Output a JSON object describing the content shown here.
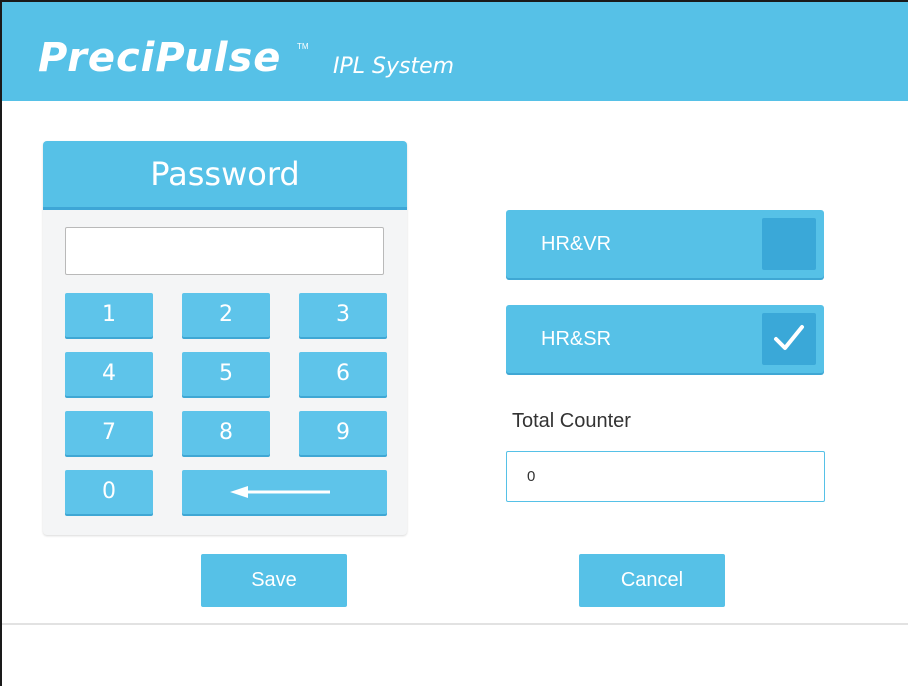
{
  "header": {
    "logo": "PreciPulse",
    "trademark": "TM",
    "subtitle": "IPL System",
    "color": "#56c1e7"
  },
  "keypad": {
    "title": "Password",
    "password_value": "",
    "keys": [
      "1",
      "2",
      "3",
      "4",
      "5",
      "6",
      "7",
      "8",
      "9",
      "0"
    ],
    "backspace_icon": "left-arrow-icon"
  },
  "options": {
    "hrvr": {
      "label": "HR&VR",
      "checked": false
    },
    "hrsr": {
      "label": "HR&SR",
      "checked": true
    }
  },
  "counter": {
    "label": "Total Counter",
    "value": "0"
  },
  "actions": {
    "save_label": "Save",
    "cancel_label": "Cancel"
  }
}
